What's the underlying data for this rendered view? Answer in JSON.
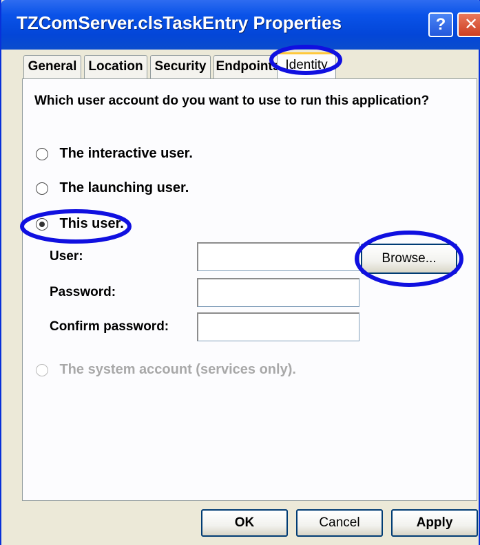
{
  "window": {
    "title": "TZComServer.clsTaskEntry Properties",
    "help_glyph": "?",
    "close_glyph": "✕"
  },
  "tabs": [
    {
      "label": "General",
      "active": false
    },
    {
      "label": "Location",
      "active": false
    },
    {
      "label": "Security",
      "active": false
    },
    {
      "label": "Endpoints",
      "active": false
    },
    {
      "label": "Identity",
      "active": true
    }
  ],
  "identity": {
    "question": "Which user account do you want to use to run this application?",
    "options": [
      {
        "label": "The interactive user.",
        "checked": false,
        "enabled": true
      },
      {
        "label": "The launching user.",
        "checked": false,
        "enabled": true
      },
      {
        "label": "This user.",
        "checked": true,
        "enabled": true
      },
      {
        "label": "The system account (services only).",
        "checked": false,
        "enabled": false
      }
    ],
    "fields": [
      {
        "label": "User:",
        "value": ""
      },
      {
        "label": "Password:",
        "value": ""
      },
      {
        "label": "Confirm password:",
        "value": ""
      }
    ],
    "browse_label": "Browse..."
  },
  "buttons": {
    "ok": "OK",
    "cancel": "Cancel",
    "apply": "Apply"
  },
  "colors": {
    "titlebar": "#0a53e8",
    "annotation_circle": "#1010e0",
    "tab_highlight": "#ffc83c",
    "dialog_bg": "#ece9d8"
  }
}
